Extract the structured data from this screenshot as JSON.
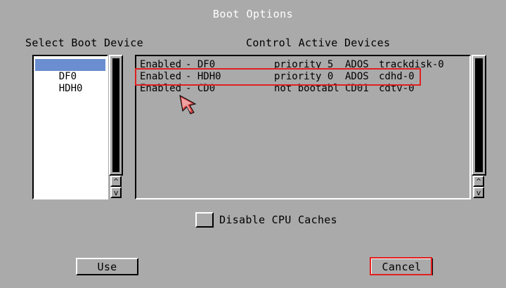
{
  "window": {
    "title": "Boot Options"
  },
  "boot_device": {
    "label": "Select Boot Device",
    "items": [
      {
        "label": "DF0",
        "selected": true
      },
      {
        "label": "HDH0",
        "selected": false
      }
    ],
    "scroll_up": "^",
    "scroll_down": "v"
  },
  "active_devices": {
    "label": "Control Active Devices",
    "rows": [
      {
        "status": "Enabled",
        "device": "- DF0",
        "priority": "priority 5",
        "fs": "ADOS",
        "driver": "trackdisk-0"
      },
      {
        "status": "Enabled",
        "device": "- HDH0",
        "priority": "priority 0",
        "fs": "ADOS",
        "driver": "cdhd-0"
      },
      {
        "status": "Enabled",
        "device": "- CD0",
        "priority": "not bootabl",
        "fs": "CD01",
        "driver": "cdtv-0"
      }
    ],
    "scroll_up": "^",
    "scroll_down": "v"
  },
  "options": {
    "disable_cpu_caches_label": "Disable CPU Caches",
    "disable_cpu_caches_checked": false
  },
  "buttons": {
    "use": "Use",
    "cancel": "Cancel"
  },
  "colors": {
    "background": "#aaaaaa",
    "selection": "#6a8ed0",
    "highlight": "#e02020"
  }
}
